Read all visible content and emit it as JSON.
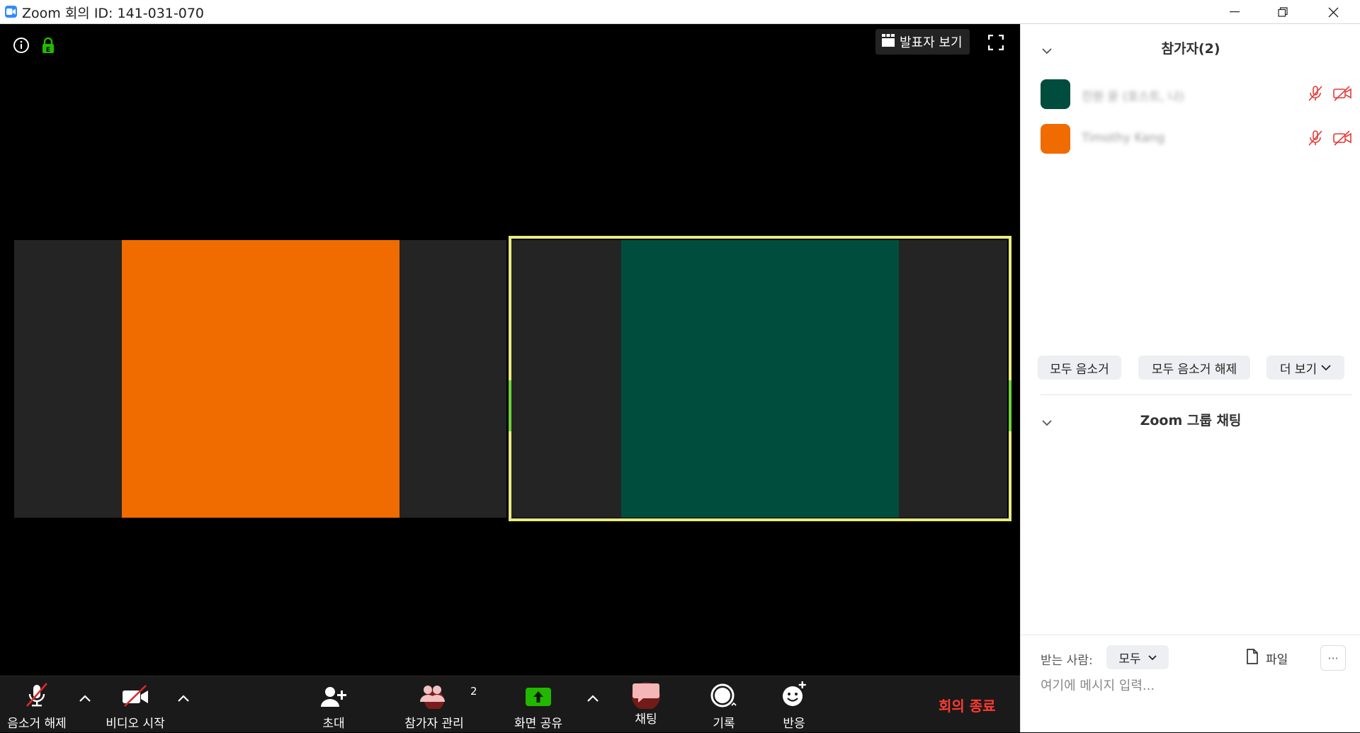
{
  "window": {
    "title": "Zoom 회의 ID: 141-031-070"
  },
  "video": {
    "speaker_view_label": "발표자 보기",
    "tiles": [
      {
        "avatar_color": "#f06b00",
        "active_speaker": false
      },
      {
        "avatar_color": "#004d3e",
        "active_speaker": true
      }
    ],
    "active_speaker_border_color": "#e8eb83"
  },
  "toolbar": {
    "unmute_label": "음소거 해제",
    "start_video_label": "비디오 시작",
    "invite_label": "초대",
    "participants_label": "참가자 관리",
    "participants_count": "2",
    "share_label": "화면 공유",
    "chat_label": "채팅",
    "record_label": "기록",
    "reactions_label": "반응",
    "end_label": "회의 종료",
    "share_color": "#23b800",
    "end_color": "#ff3b30"
  },
  "panel": {
    "participants_title": "참가자(2)",
    "participants": [
      {
        "name": "진원 윤 (호스트, 나)",
        "avatar_color": "#004d3e"
      },
      {
        "name": "Timothy Kang",
        "avatar_color": "#f06b00"
      }
    ],
    "mute_all_label": "모두 음소거",
    "unmute_all_label": "모두 음소거 해제",
    "more_label": "더 보기",
    "chat_title": "Zoom 그룹 채팅",
    "to_label": "받는 사람:",
    "to_value": "모두",
    "file_label": "파일",
    "more_dots": "···",
    "message_placeholder": "여기에 메시지 입력..."
  }
}
